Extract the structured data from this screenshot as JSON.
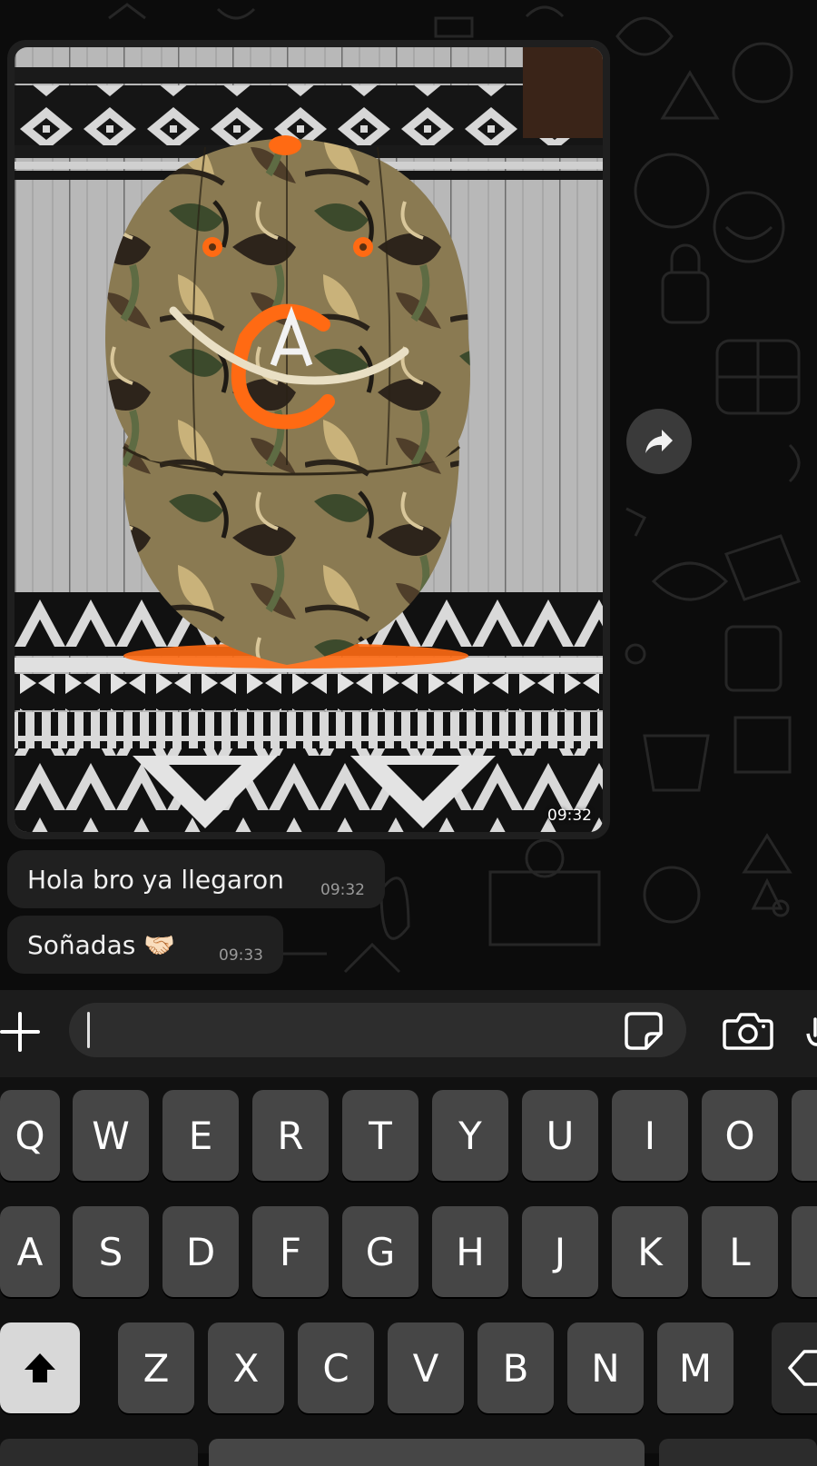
{
  "messages": [
    {
      "type": "image",
      "time": "09:32"
    },
    {
      "type": "text",
      "text": "Hola bro ya llegaron",
      "time": "09:32"
    },
    {
      "type": "text",
      "text": "Soñadas 🤝🏻",
      "time": "09:33"
    }
  ],
  "composer": {
    "placeholder": "",
    "icons": {
      "attach": "plus-icon",
      "sticker": "sticker-icon",
      "camera": "camera-icon",
      "mic": "microphone-icon"
    }
  },
  "keyboard": {
    "row1": [
      "Q",
      "W",
      "E",
      "R",
      "T",
      "Y",
      "U",
      "I",
      "O"
    ],
    "row2": [
      "A",
      "S",
      "D",
      "F",
      "G",
      "H",
      "J",
      "K",
      "L"
    ],
    "row3": [
      "Z",
      "X",
      "C",
      "V",
      "B",
      "N",
      "M"
    ],
    "icons": {
      "shift": "shift-icon",
      "delete": "backspace-icon"
    }
  },
  "colors": {
    "background": "#0b0b0b",
    "bubble": "#202020",
    "key": "#464646",
    "accent_orange": "#ff6a13"
  }
}
